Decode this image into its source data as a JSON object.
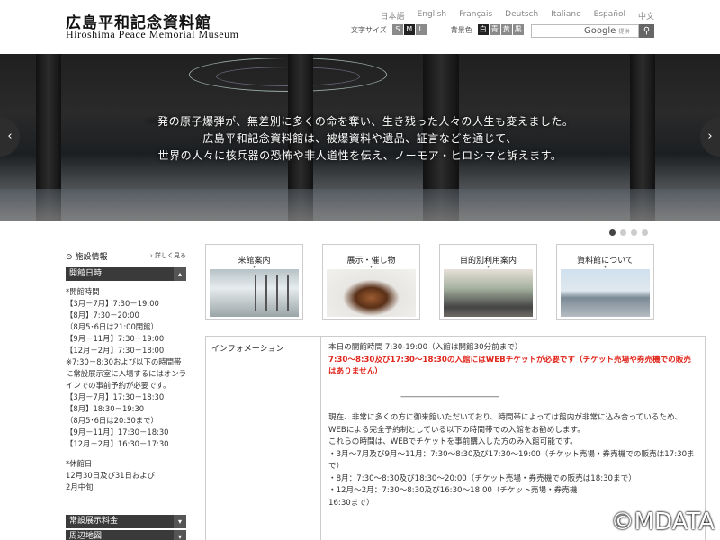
{
  "header": {
    "title_jp": "広島平和記念資料館",
    "title_en": "Hiroshima Peace Memorial Museum",
    "languages": [
      "日本語",
      "English",
      "Français",
      "Deutsch",
      "Italiano",
      "Español",
      "中文"
    ],
    "font_size_label": "文字サイズ",
    "font_sizes": [
      "S",
      "M",
      "L"
    ],
    "bg_color_label": "背景色",
    "bg_colors": [
      "白",
      "青",
      "黄",
      "黒"
    ],
    "search_brand": "Google",
    "search_sub": "提供",
    "search_icon": "search-icon"
  },
  "hero": {
    "lines": [
      "一発の原子爆弾が、無差別に多くの命を奪い、生き残った人々の人生も変えました。",
      "広島平和記念資料館は、被爆資料や遺品、証言などを通じて、",
      "世界の人々に核兵器の恐怖や非人道性を伝え、ノーモア・ヒロシマと訴えます。"
    ],
    "prev": "‹",
    "next": "›",
    "slide_count": 4,
    "active_slide": 1
  },
  "sidebar": {
    "heading": "施設情報",
    "more": "› 詳しく見る",
    "section_title": "開館日時",
    "hours_lines": [
      "*開館時間",
      "【3月－7月】7:30－19:00",
      "【8月】7:30－20:00",
      "（8月5･6日は21:00閉館）",
      "【9月－11月】7:30－19:00",
      "【12月－2月】7:30－18:00",
      "※7:30－8:30および以下の時間帯に常設展示室に入場するにはオンラインでの事前予約が必要です。",
      "【3月－7月】17:30－18:30",
      "【8月】18:30－19:30",
      "（8月5･6日は20:30まで）",
      "【9月－11月】17:30－18:30",
      "【12月－2月】16:30－17:30",
      "",
      "*休館日",
      "12月30日及び31日および",
      "2月中旬"
    ],
    "bottom_items": [
      "常設展示料金",
      "周辺地図"
    ],
    "chevron": "▾"
  },
  "tiles": [
    {
      "label": "来館案内"
    },
    {
      "label": "展示・催し物"
    },
    {
      "label": "目的別利用案内"
    },
    {
      "label": "資料館について"
    }
  ],
  "info": {
    "heading": "インフォメーション",
    "line1": "本日の開館時間 7:30-19:00（入館は開館30分前まで）",
    "red": "7:30～8:30及び17:30～18:30の入館にはWEBチケットが必要です（チケット売場や券売機での販売はありません）",
    "rule": "----------------------------------------------------",
    "para1": "現在、非常に多くの方に御来館いただいており、時間帯によっては館内が非常に込み合っているため、WEBによる完全予約制としている以下の時間帯での入館をお勧めします。",
    "para2": "これらの時間は、WEBでチケットを事前購入した方のみ入館可能です。",
    "item1": "・3月～7月及び9月～11月：7:30～8:30及び17:30～19:00（チケット売場・券売機での販売は17:30まで）",
    "item2": "・8月：7:30～8:30及び18:30～20:00（チケット売場・券売機での販売は18:30まで）",
    "item3": "・12月～2月：7:30～8:30及び16:30～18:00（チケット売場・券売機",
    "item3b": "16:30まで）"
  },
  "watermark": "©MDATA"
}
